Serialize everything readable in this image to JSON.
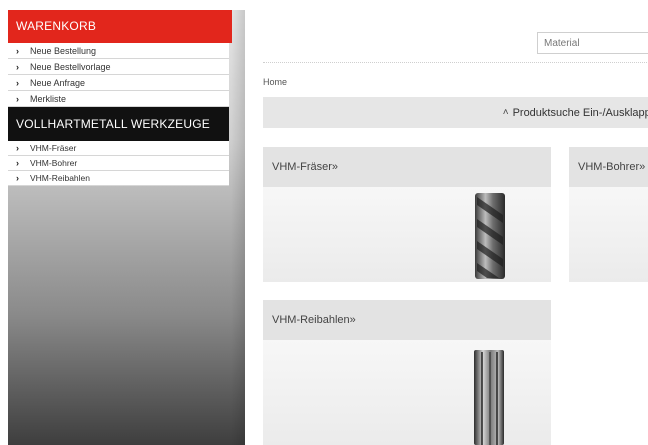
{
  "sidebar": {
    "cart_title": "WARENKORB",
    "cart_items": [
      {
        "label": "Neue Bestellung"
      },
      {
        "label": "Neue Bestellvorlage"
      },
      {
        "label": "Neue Anfrage"
      },
      {
        "label": "Merkliste"
      }
    ],
    "tools_title": "VOLLHARTMETALL WERKZEUGE",
    "tool_items": [
      {
        "label": "VHM-Fräser"
      },
      {
        "label": "VHM-Bohrer"
      },
      {
        "label": "VHM-Reibahlen"
      }
    ],
    "arrow_glyph": "›"
  },
  "header": {
    "material_placeholder": "Material"
  },
  "breadcrumb": "Home",
  "product_search_toggle": "Produktsuche Ein-/Ausklappen",
  "product_search_icon": "double-chevron-up-icon",
  "categories": [
    {
      "title": "VHM-Fräser»"
    },
    {
      "title": "VHM-Bohrer»"
    },
    {
      "title": "VHM-Reibahlen»"
    }
  ],
  "colors": {
    "cart_header": "#e2261c",
    "tools_header": "#111111"
  }
}
